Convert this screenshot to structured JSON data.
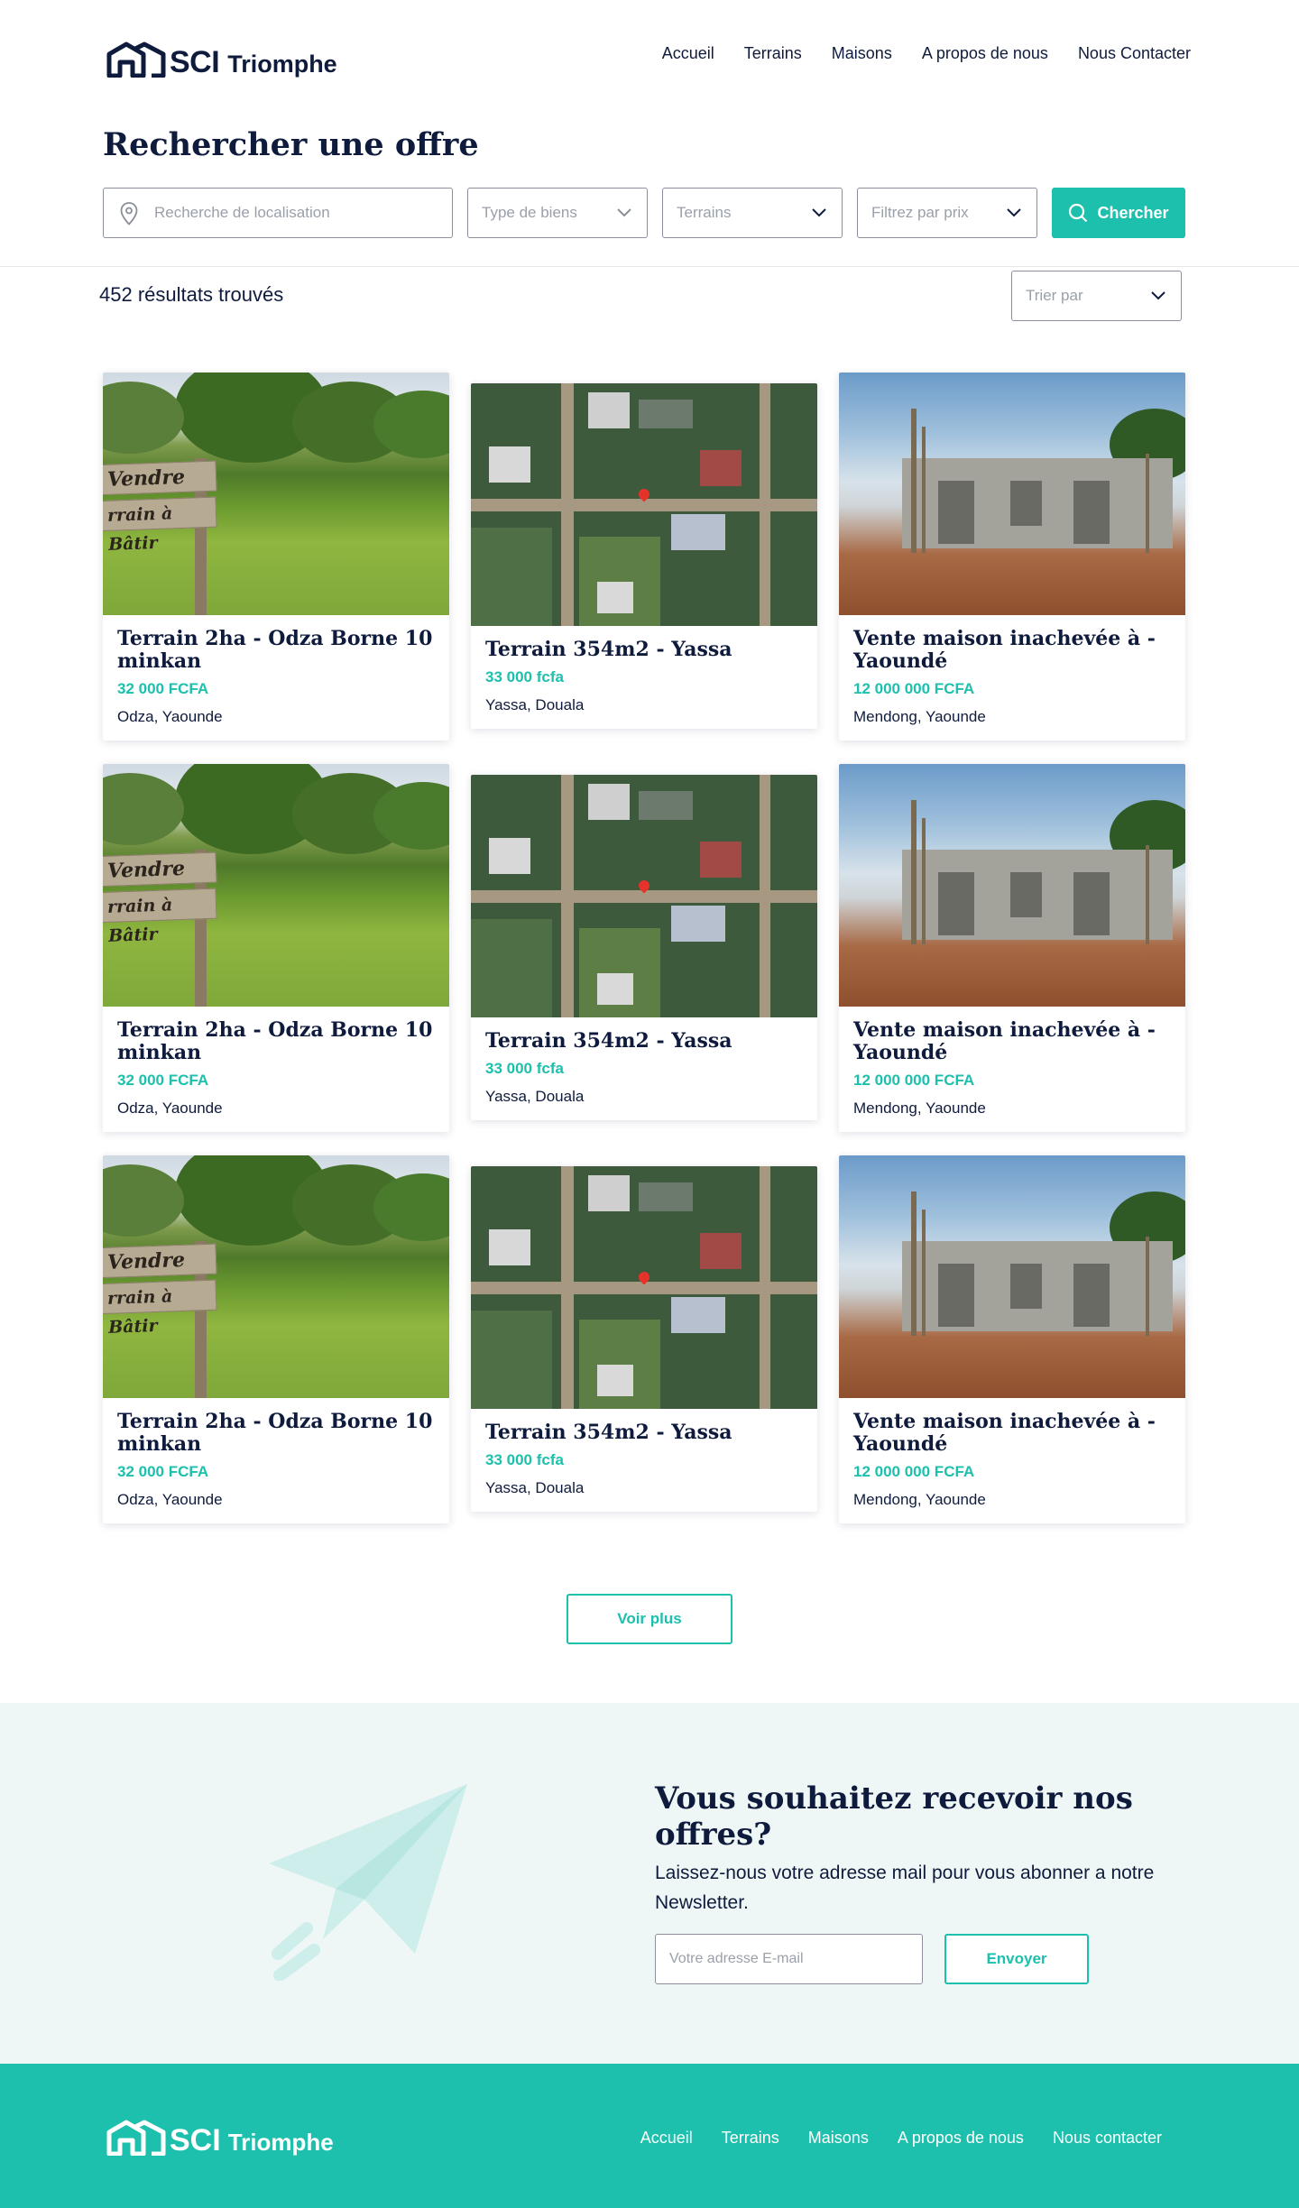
{
  "header": {
    "logo_sci": "SCI",
    "logo_name": "Triomphe",
    "nav": [
      "Accueil",
      "Terrains",
      "Maisons",
      "A propos de nous",
      "Nous Contacter"
    ]
  },
  "search": {
    "title": "Rechercher une offre",
    "location_placeholder": "Recherche de localisation",
    "type_placeholder": "Type de biens",
    "terrains_placeholder": "Terrains",
    "price_placeholder": "Filtrez par prix",
    "button_label": "Chercher"
  },
  "results": {
    "count_text": "452 résultats trouvés",
    "sort_placeholder": "Trier par"
  },
  "listings": [
    {
      "title": "Terrain 2ha - Odza Borne 10 minkan",
      "price": "32 000 FCFA",
      "location": "Odza, Yaounde",
      "image": "land-for-sale-sign"
    },
    {
      "title": "Terrain 354m2 - Yassa",
      "price": "33 000 fcfa",
      "location": "Yassa, Douala",
      "image": "aerial-map"
    },
    {
      "title": "Vente maison inachevée à - Yaoundé",
      "price": "12 000 000 FCFA",
      "location": "Mendong, Yaounde",
      "image": "unfinished-house"
    },
    {
      "title": "Terrain 2ha - Odza Borne 10 minkan",
      "price": "32 000 FCFA",
      "location": "Odza, Yaounde",
      "image": "land-for-sale-sign"
    },
    {
      "title": "Terrain 354m2 - Yassa",
      "price": "33 000 fcfa",
      "location": "Yassa, Douala",
      "image": "aerial-map"
    },
    {
      "title": "Vente maison inachevée à - Yaoundé",
      "price": "12 000 000 FCFA",
      "location": "Mendong, Yaounde",
      "image": "unfinished-house"
    },
    {
      "title": "Terrain 2ha - Odza Borne 10 minkan",
      "price": "32 000 FCFA",
      "location": "Odza, Yaounde",
      "image": "land-for-sale-sign"
    },
    {
      "title": "Terrain 354m2 - Yassa",
      "price": "33 000 fcfa",
      "location": "Yassa, Douala",
      "image": "aerial-map"
    },
    {
      "title": "Vente maison inachevée à - Yaoundé",
      "price": "12 000 000 FCFA",
      "location": "Mendong, Yaounde",
      "image": "unfinished-house"
    }
  ],
  "sign_text": {
    "line1": "Vendre",
    "line2": "rrain à Bâtir"
  },
  "more_button": "Voir plus",
  "newsletter": {
    "title": "Vous souhaitez recevoir nos offres?",
    "text": "Laissez-nous votre adresse mail pour vous abonner a notre Newsletter.",
    "email_placeholder": "Votre adresse E-mail",
    "button_label": "Envoyer"
  },
  "footer": {
    "logo_sci": "SCI",
    "logo_name": "Triomphe",
    "nav": [
      "Accueil",
      "Terrains",
      "Maisons",
      "A propos de nous",
      "Nous contacter"
    ]
  },
  "colors": {
    "accent": "#1cc0ad",
    "navy": "#0f1b3d",
    "newsletter_bg": "#eff7f6"
  }
}
